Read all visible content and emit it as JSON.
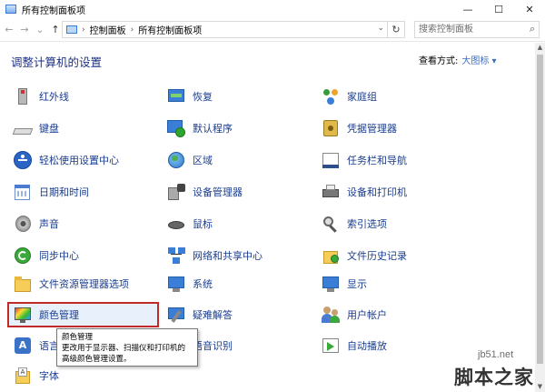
{
  "window": {
    "title": "所有控制面板项",
    "minimize": "—",
    "maximize": "☐",
    "close": "✕"
  },
  "address": {
    "back": "←",
    "forward": "→",
    "recent": "⌄",
    "up": "↑",
    "sep": "›",
    "crumbs": [
      "控制面板",
      "所有控制面板项"
    ],
    "dropdown": "⌄",
    "refresh": "↻",
    "search_placeholder": "搜索控制面板",
    "search_icon": "⌕"
  },
  "heading": "调整计算机的设置",
  "view_by": {
    "label": "查看方式:",
    "value": "大图标 ▾"
  },
  "items": [
    {
      "label": "红外线",
      "icon": "infrared-icon"
    },
    {
      "label": "恢复",
      "icon": "recovery-icon"
    },
    {
      "label": "家庭组",
      "icon": "homegroup-icon"
    },
    {
      "label": "键盘",
      "icon": "keyboard-icon"
    },
    {
      "label": "默认程序",
      "icon": "default-programs-icon"
    },
    {
      "label": "凭据管理器",
      "icon": "credential-manager-icon"
    },
    {
      "label": "轻松使用设置中心",
      "icon": "ease-of-access-icon"
    },
    {
      "label": "区域",
      "icon": "region-icon"
    },
    {
      "label": "任务栏和导航",
      "icon": "taskbar-icon"
    },
    {
      "label": "日期和时间",
      "icon": "date-time-icon"
    },
    {
      "label": "设备管理器",
      "icon": "device-manager-icon"
    },
    {
      "label": "设备和打印机",
      "icon": "devices-printers-icon"
    },
    {
      "label": "声音",
      "icon": "sound-icon"
    },
    {
      "label": "鼠标",
      "icon": "mouse-icon"
    },
    {
      "label": "索引选项",
      "icon": "indexing-icon"
    },
    {
      "label": "同步中心",
      "icon": "sync-center-icon"
    },
    {
      "label": "网络和共享中心",
      "icon": "network-icon"
    },
    {
      "label": "文件历史记录",
      "icon": "file-history-icon"
    },
    {
      "label": "文件资源管理器选项",
      "icon": "folder-options-icon"
    },
    {
      "label": "系统",
      "icon": "system-icon"
    },
    {
      "label": "显示",
      "icon": "display-icon"
    },
    {
      "label": "颜色管理",
      "icon": "color-management-icon"
    },
    {
      "label": "疑难解答",
      "icon": "troubleshooting-icon"
    },
    {
      "label": "用户帐户",
      "icon": "user-accounts-icon"
    },
    {
      "label": "语言",
      "icon": "language-icon"
    },
    {
      "label": "语音识别",
      "icon": "speech-recognition-icon"
    },
    {
      "label": "自动播放",
      "icon": "autoplay-icon"
    },
    {
      "label": "字体",
      "icon": "fonts-icon"
    }
  ],
  "tooltip": {
    "title": "颜色管理",
    "line1": "更改用于显示器、扫描仪和打印机的",
    "line2": "高级颜色管理设置。"
  },
  "scrollbar": {
    "up": "▲",
    "down": "▼"
  },
  "watermark": {
    "url": "jb51.net",
    "brand": "脚本之家"
  },
  "colors": {
    "link": "#1a3d8f",
    "heading": "#1e3287",
    "selection_border": "#c22a2a",
    "selection_fill": "#e8f1fb"
  }
}
